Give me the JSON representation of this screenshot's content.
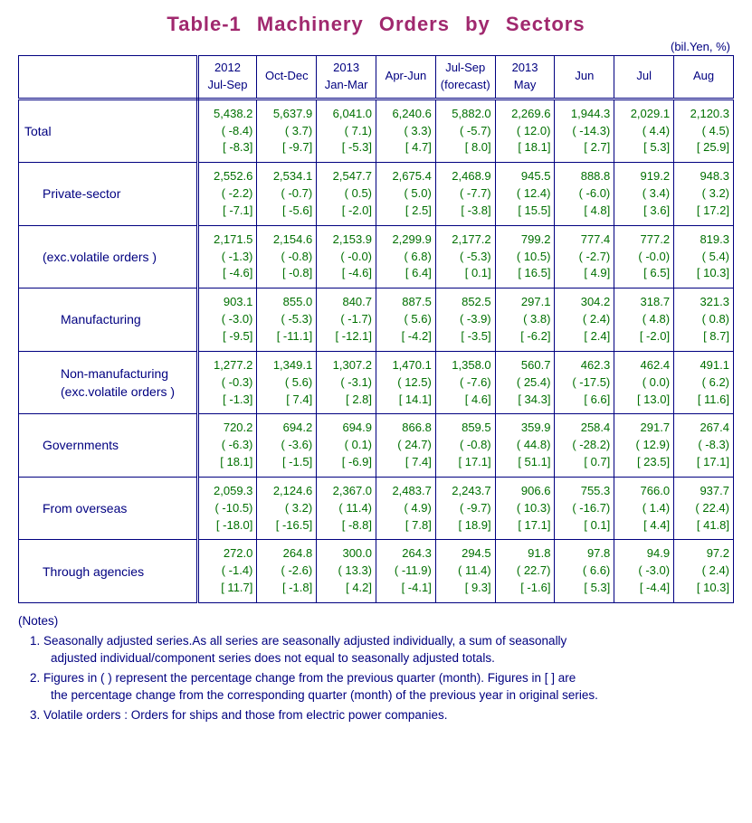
{
  "title": "Table-1   Machinery   Orders   by   Sectors",
  "unit": "(bil.Yen, %)",
  "columns": [
    {
      "year": "2012",
      "period": "Jul-Sep",
      "note": ""
    },
    {
      "year": "",
      "period": "Oct-Dec",
      "note": ""
    },
    {
      "year": "2013",
      "period": "Jan-Mar",
      "note": ""
    },
    {
      "year": "",
      "period": "Apr-Jun",
      "note": ""
    },
    {
      "year": "",
      "period": "Jul-Sep",
      "note": "(forecast)"
    },
    {
      "year": "2013",
      "period": "May",
      "note": ""
    },
    {
      "year": "",
      "period": "Jun",
      "note": ""
    },
    {
      "year": "",
      "period": "Jul",
      "note": ""
    },
    {
      "year": "",
      "period": "Aug",
      "note": ""
    }
  ],
  "rows": [
    {
      "label": "Total",
      "indent": 0,
      "cells": [
        {
          "v": "5,438.2",
          "q": "( -8.4)",
          "y": "[ -8.3]"
        },
        {
          "v": "5,637.9",
          "q": "( 3.7)",
          "y": "[ -9.7]"
        },
        {
          "v": "6,041.0",
          "q": "( 7.1)",
          "y": "[ -5.3]"
        },
        {
          "v": "6,240.6",
          "q": "( 3.3)",
          "y": "[ 4.7]"
        },
        {
          "v": "5,882.0",
          "q": "( -5.7)",
          "y": "[ 8.0]"
        },
        {
          "v": "2,269.6",
          "q": "( 12.0)",
          "y": "[ 18.1]"
        },
        {
          "v": "1,944.3",
          "q": "( -14.3)",
          "y": "[ 2.7]"
        },
        {
          "v": "2,029.1",
          "q": "( 4.4)",
          "y": "[ 5.3]"
        },
        {
          "v": "2,120.3",
          "q": "( 4.5)",
          "y": "[ 25.9]"
        }
      ]
    },
    {
      "label": "Private-sector",
      "indent": 1,
      "cells": [
        {
          "v": "2,552.6",
          "q": "( -2.2)",
          "y": "[ -7.1]"
        },
        {
          "v": "2,534.1",
          "q": "( -0.7)",
          "y": "[ -5.6]"
        },
        {
          "v": "2,547.7",
          "q": "( 0.5)",
          "y": "[ -2.0]"
        },
        {
          "v": "2,675.4",
          "q": "( 5.0)",
          "y": "[ 2.5]"
        },
        {
          "v": "2,468.9",
          "q": "( -7.7)",
          "y": "[ -3.8]"
        },
        {
          "v": "945.5",
          "q": "( 12.4)",
          "y": "[ 15.5]"
        },
        {
          "v": "888.8",
          "q": "( -6.0)",
          "y": "[ 4.8]"
        },
        {
          "v": "919.2",
          "q": "( 3.4)",
          "y": "[ 3.6]"
        },
        {
          "v": "948.3",
          "q": "( 3.2)",
          "y": "[ 17.2]"
        }
      ]
    },
    {
      "label": "(exc.volatile orders )",
      "indent": 1,
      "cells": [
        {
          "v": "2,171.5",
          "q": "( -1.3)",
          "y": "[ -4.6]"
        },
        {
          "v": "2,154.6",
          "q": "( -0.8)",
          "y": "[ -0.8]"
        },
        {
          "v": "2,153.9",
          "q": "( -0.0)",
          "y": "[ -4.6]"
        },
        {
          "v": "2,299.9",
          "q": "( 6.8)",
          "y": "[ 6.4]"
        },
        {
          "v": "2,177.2",
          "q": "( -5.3)",
          "y": "[ 0.1]"
        },
        {
          "v": "799.2",
          "q": "( 10.5)",
          "y": "[ 16.5]"
        },
        {
          "v": "777.4",
          "q": "( -2.7)",
          "y": "[ 4.9]"
        },
        {
          "v": "777.2",
          "q": "( -0.0)",
          "y": "[ 6.5]"
        },
        {
          "v": "819.3",
          "q": "( 5.4)",
          "y": "[ 10.3]"
        }
      ]
    },
    {
      "label": "Manufacturing",
      "indent": 2,
      "cells": [
        {
          "v": "903.1",
          "q": "( -3.0)",
          "y": "[ -9.5]"
        },
        {
          "v": "855.0",
          "q": "( -5.3)",
          "y": "[ -11.1]"
        },
        {
          "v": "840.7",
          "q": "( -1.7)",
          "y": "[ -12.1]"
        },
        {
          "v": "887.5",
          "q": "( 5.6)",
          "y": "[ -4.2]"
        },
        {
          "v": "852.5",
          "q": "( -3.9)",
          "y": "[ -3.5]"
        },
        {
          "v": "297.1",
          "q": "( 3.8)",
          "y": "[ -6.2]"
        },
        {
          "v": "304.2",
          "q": "( 2.4)",
          "y": "[ 2.4]"
        },
        {
          "v": "318.7",
          "q": "( 4.8)",
          "y": "[ -2.0]"
        },
        {
          "v": "321.3",
          "q": "( 0.8)",
          "y": "[ 8.7]"
        }
      ]
    },
    {
      "label": "Non-manufacturing",
      "label2": "(exc.volatile orders )",
      "indent": 2,
      "cells": [
        {
          "v": "1,277.2",
          "q": "( -0.3)",
          "y": "[ -1.3]"
        },
        {
          "v": "1,349.1",
          "q": "( 5.6)",
          "y": "[ 7.4]"
        },
        {
          "v": "1,307.2",
          "q": "( -3.1)",
          "y": "[ 2.8]"
        },
        {
          "v": "1,470.1",
          "q": "( 12.5)",
          "y": "[ 14.1]"
        },
        {
          "v": "1,358.0",
          "q": "( -7.6)",
          "y": "[ 4.6]"
        },
        {
          "v": "560.7",
          "q": "( 25.4)",
          "y": "[ 34.3]"
        },
        {
          "v": "462.3",
          "q": "( -17.5)",
          "y": "[ 6.6]"
        },
        {
          "v": "462.4",
          "q": "( 0.0)",
          "y": "[ 13.0]"
        },
        {
          "v": "491.1",
          "q": "( 6.2)",
          "y": "[ 11.6]"
        }
      ]
    },
    {
      "label": "Governments",
      "indent": 1,
      "cells": [
        {
          "v": "720.2",
          "q": "( -6.3)",
          "y": "[ 18.1]"
        },
        {
          "v": "694.2",
          "q": "( -3.6)",
          "y": "[ -1.5]"
        },
        {
          "v": "694.9",
          "q": "( 0.1)",
          "y": "[ -6.9]"
        },
        {
          "v": "866.8",
          "q": "( 24.7)",
          "y": "[ 7.4]"
        },
        {
          "v": "859.5",
          "q": "( -0.8)",
          "y": "[ 17.1]"
        },
        {
          "v": "359.9",
          "q": "( 44.8)",
          "y": "[ 51.1]"
        },
        {
          "v": "258.4",
          "q": "( -28.2)",
          "y": "[ 0.7]"
        },
        {
          "v": "291.7",
          "q": "( 12.9)",
          "y": "[ 23.5]"
        },
        {
          "v": "267.4",
          "q": "( -8.3)",
          "y": "[ 17.1]"
        }
      ]
    },
    {
      "label": "From overseas",
      "indent": 1,
      "cells": [
        {
          "v": "2,059.3",
          "q": "( -10.5)",
          "y": "[ -18.0]"
        },
        {
          "v": "2,124.6",
          "q": "( 3.2)",
          "y": "[ -16.5]"
        },
        {
          "v": "2,367.0",
          "q": "( 11.4)",
          "y": "[ -8.8]"
        },
        {
          "v": "2,483.7",
          "q": "( 4.9)",
          "y": "[ 7.8]"
        },
        {
          "v": "2,243.7",
          "q": "( -9.7)",
          "y": "[ 18.9]"
        },
        {
          "v": "906.6",
          "q": "( 10.3)",
          "y": "[ 17.1]"
        },
        {
          "v": "755.3",
          "q": "( -16.7)",
          "y": "[ 0.1]"
        },
        {
          "v": "766.0",
          "q": "( 1.4)",
          "y": "[ 4.4]"
        },
        {
          "v": "937.7",
          "q": "( 22.4)",
          "y": "[ 41.8]"
        }
      ]
    },
    {
      "label": "Through agencies",
      "indent": 1,
      "cells": [
        {
          "v": "272.0",
          "q": "( -1.4)",
          "y": "[ 11.7]"
        },
        {
          "v": "264.8",
          "q": "( -2.6)",
          "y": "[ -1.8]"
        },
        {
          "v": "300.0",
          "q": "( 13.3)",
          "y": "[ 4.2]"
        },
        {
          "v": "264.3",
          "q": "( -11.9)",
          "y": "[ -4.1]"
        },
        {
          "v": "294.5",
          "q": "( 11.4)",
          "y": "[ 9.3]"
        },
        {
          "v": "91.8",
          "q": "( 22.7)",
          "y": "[ -1.6]"
        },
        {
          "v": "97.8",
          "q": "( 6.6)",
          "y": "[ 5.3]"
        },
        {
          "v": "94.9",
          "q": "( -3.0)",
          "y": "[ -4.4]"
        },
        {
          "v": "97.2",
          "q": "( 2.4)",
          "y": "[ 10.3]"
        }
      ]
    }
  ],
  "notes": {
    "heading": "(Notes)",
    "items": [
      {
        "a": "Seasonally adjusted series.As all series are seasonally adjusted individually, a sum of seasonally",
        "b": "adjusted individual/component series does not equal to seasonally adjusted totals."
      },
      {
        "a": "Figures in ( ) represent the percentage change from the previous quarter (month). Figures in [ ] are",
        "b": "the percentage change from the corresponding quarter (month) of the previous year in original series."
      },
      {
        "a": "Volatile orders : Orders for ships and those from electric power companies.",
        "b": ""
      }
    ]
  },
  "chart_data": {
    "type": "table",
    "unit": "bil.Yen; ( ) = % chg from prev period; [ ] = % chg from year earlier (original series)",
    "columns": [
      "2012 Jul-Sep",
      "Oct-Dec",
      "2013 Jan-Mar",
      "Apr-Jun",
      "Jul-Sep (forecast)",
      "2013 May",
      "Jun",
      "Jul",
      "Aug"
    ],
    "series": [
      {
        "name": "Total",
        "values": [
          5438.2,
          5637.9,
          6041.0,
          6240.6,
          5882.0,
          2269.6,
          1944.3,
          2029.1,
          2120.3
        ],
        "qoq_pct": [
          -8.4,
          3.7,
          7.1,
          3.3,
          -5.7,
          12.0,
          -14.3,
          4.4,
          4.5
        ],
        "yoy_pct": [
          -8.3,
          -9.7,
          -5.3,
          4.7,
          8.0,
          18.1,
          2.7,
          5.3,
          25.9
        ]
      },
      {
        "name": "Private-sector",
        "values": [
          2552.6,
          2534.1,
          2547.7,
          2675.4,
          2468.9,
          945.5,
          888.8,
          919.2,
          948.3
        ],
        "qoq_pct": [
          -2.2,
          -0.7,
          0.5,
          5.0,
          -7.7,
          12.4,
          -6.0,
          3.4,
          3.2
        ],
        "yoy_pct": [
          -7.1,
          -5.6,
          -2.0,
          2.5,
          -3.8,
          15.5,
          4.8,
          3.6,
          17.2
        ]
      },
      {
        "name": "Private-sector (exc. volatile orders)",
        "values": [
          2171.5,
          2154.6,
          2153.9,
          2299.9,
          2177.2,
          799.2,
          777.4,
          777.2,
          819.3
        ],
        "qoq_pct": [
          -1.3,
          -0.8,
          -0.0,
          6.8,
          -5.3,
          10.5,
          -2.7,
          -0.0,
          5.4
        ],
        "yoy_pct": [
          -4.6,
          -0.8,
          -4.6,
          6.4,
          0.1,
          16.5,
          4.9,
          6.5,
          10.3
        ]
      },
      {
        "name": "Manufacturing",
        "values": [
          903.1,
          855.0,
          840.7,
          887.5,
          852.5,
          297.1,
          304.2,
          318.7,
          321.3
        ],
        "qoq_pct": [
          -3.0,
          -5.3,
          -1.7,
          5.6,
          -3.9,
          3.8,
          2.4,
          4.8,
          0.8
        ],
        "yoy_pct": [
          -9.5,
          -11.1,
          -12.1,
          -4.2,
          -3.5,
          -6.2,
          2.4,
          -2.0,
          8.7
        ]
      },
      {
        "name": "Non-manufacturing (exc. volatile orders)",
        "values": [
          1277.2,
          1349.1,
          1307.2,
          1470.1,
          1358.0,
          560.7,
          462.3,
          462.4,
          491.1
        ],
        "qoq_pct": [
          -0.3,
          5.6,
          -3.1,
          12.5,
          -7.6,
          25.4,
          -17.5,
          0.0,
          6.2
        ],
        "yoy_pct": [
          -1.3,
          7.4,
          2.8,
          14.1,
          4.6,
          34.3,
          6.6,
          13.0,
          11.6
        ]
      },
      {
        "name": "Governments",
        "values": [
          720.2,
          694.2,
          694.9,
          866.8,
          859.5,
          359.9,
          258.4,
          291.7,
          267.4
        ],
        "qoq_pct": [
          -6.3,
          -3.6,
          0.1,
          24.7,
          -0.8,
          44.8,
          -28.2,
          12.9,
          -8.3
        ],
        "yoy_pct": [
          18.1,
          -1.5,
          -6.9,
          7.4,
          17.1,
          51.1,
          0.7,
          23.5,
          17.1
        ]
      },
      {
        "name": "From overseas",
        "values": [
          2059.3,
          2124.6,
          2367.0,
          2483.7,
          2243.7,
          906.6,
          755.3,
          766.0,
          937.7
        ],
        "qoq_pct": [
          -10.5,
          3.2,
          11.4,
          4.9,
          -9.7,
          10.3,
          -16.7,
          1.4,
          22.4
        ],
        "yoy_pct": [
          -18.0,
          -16.5,
          -8.8,
          7.8,
          18.9,
          17.1,
          0.1,
          4.4,
          41.8
        ]
      },
      {
        "name": "Through agencies",
        "values": [
          272.0,
          264.8,
          300.0,
          264.3,
          294.5,
          91.8,
          97.8,
          94.9,
          97.2
        ],
        "qoq_pct": [
          -1.4,
          -2.6,
          13.3,
          -11.9,
          11.4,
          22.7,
          6.6,
          -3.0,
          2.4
        ],
        "yoy_pct": [
          11.7,
          -1.8,
          4.2,
          -4.1,
          9.3,
          -1.6,
          5.3,
          -4.4,
          10.3
        ]
      }
    ]
  }
}
